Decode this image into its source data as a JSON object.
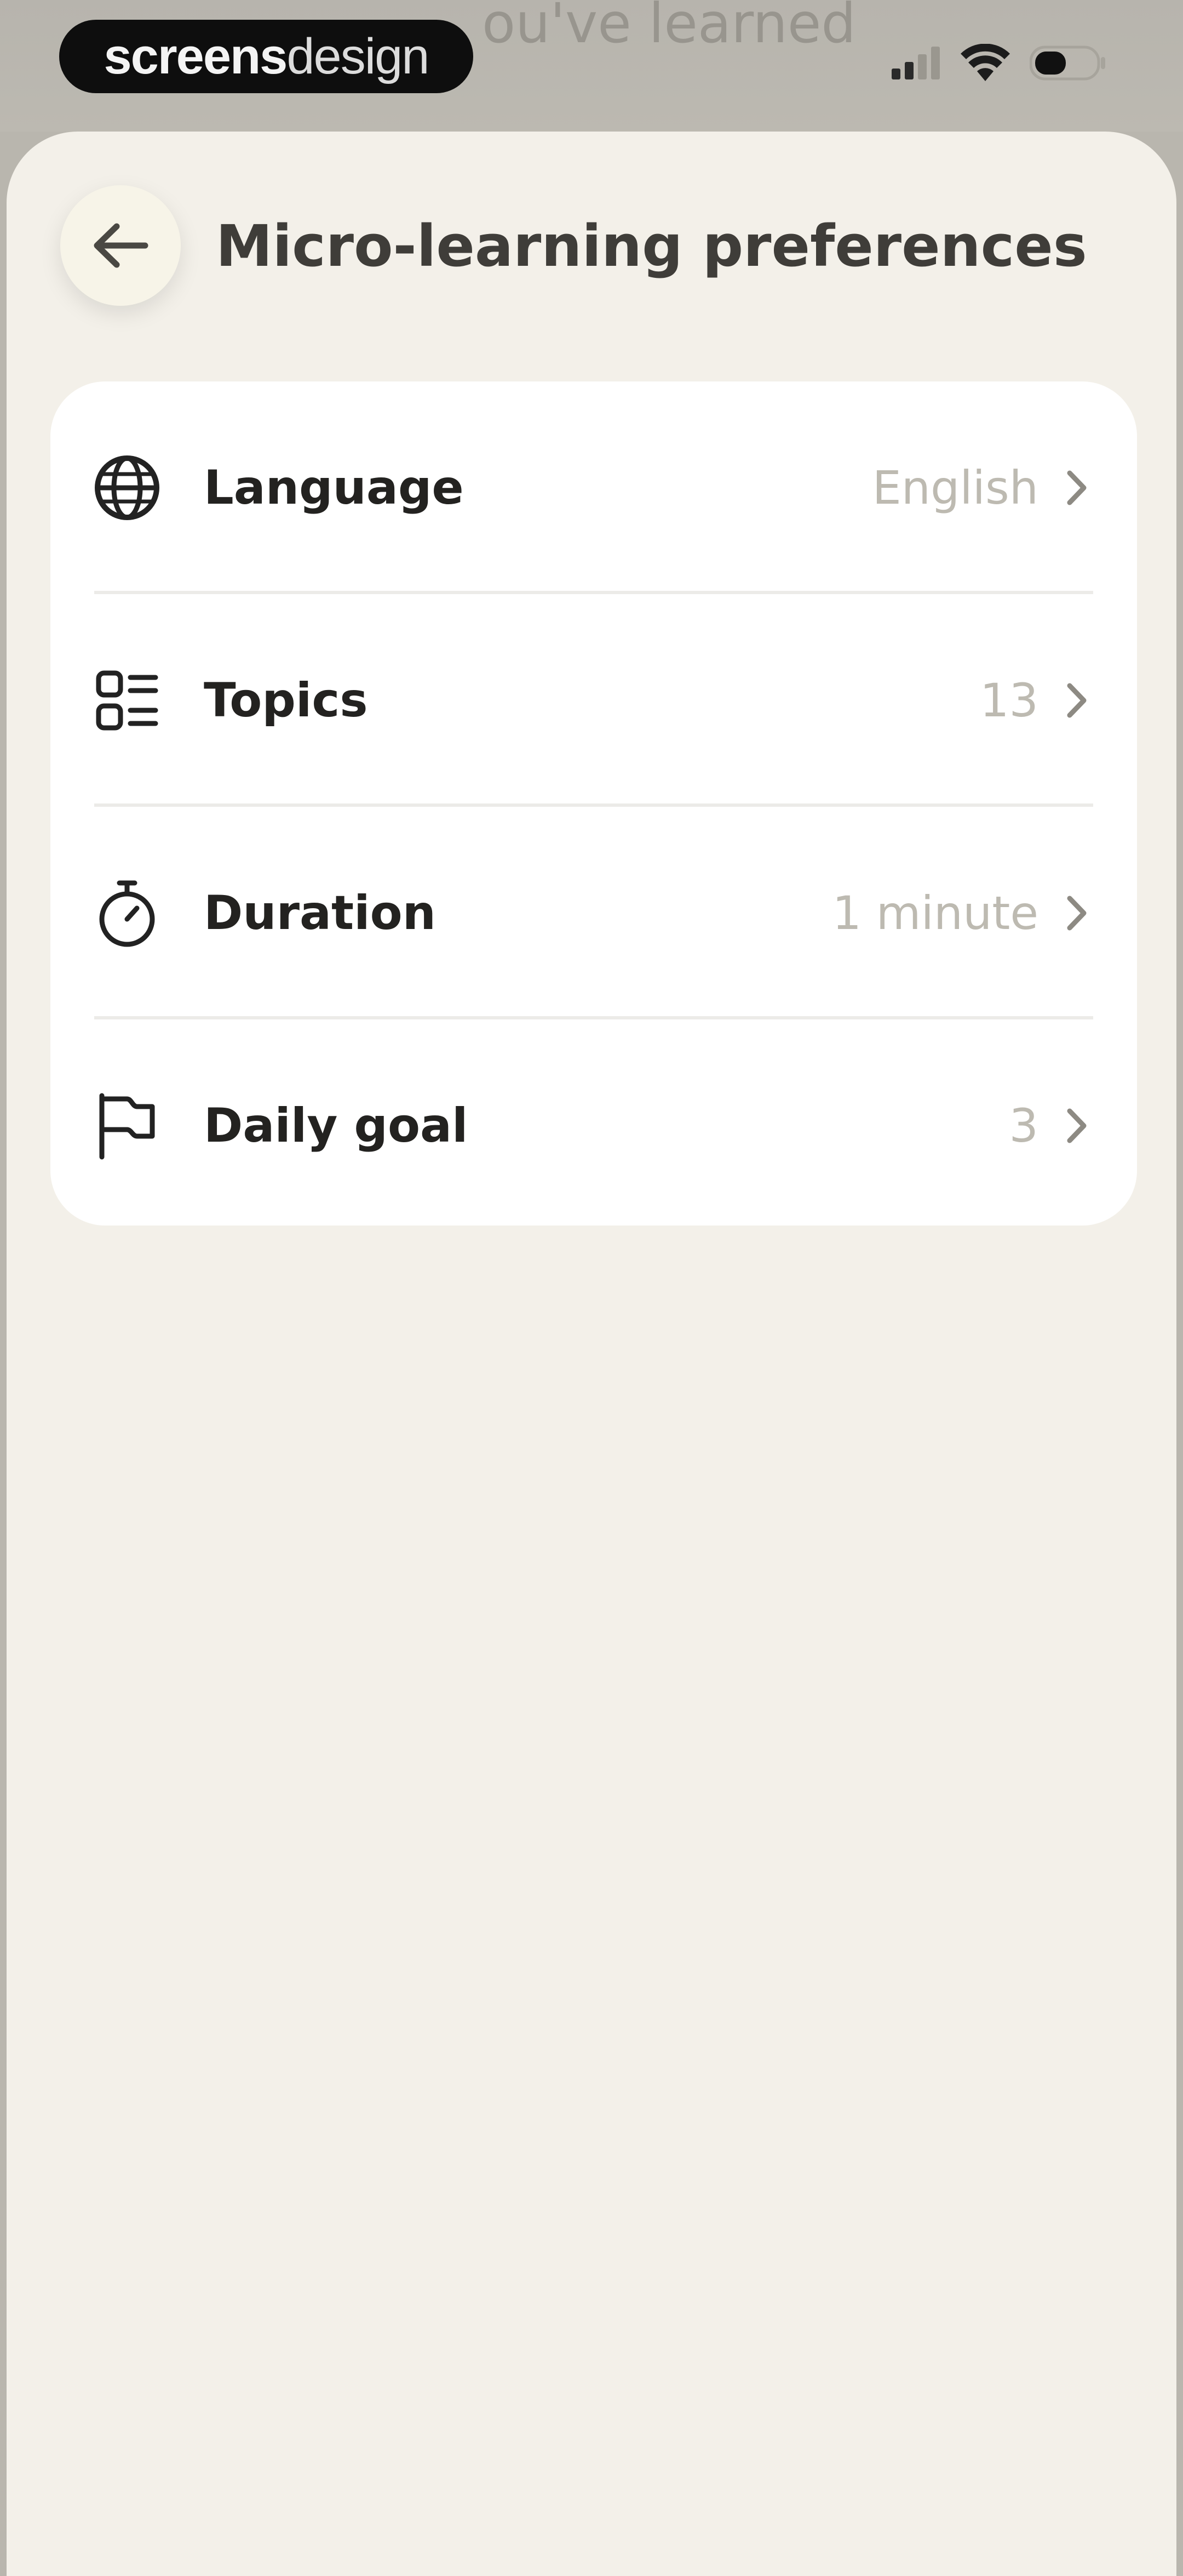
{
  "status_bar": {
    "brand_bold": "screens",
    "brand_light": "design",
    "behind_text": "ou've learned"
  },
  "header": {
    "back_label": "Back",
    "title": "Micro-learning preferences"
  },
  "settings": {
    "items": [
      {
        "icon": "globe-icon",
        "label": "Language",
        "value": "English"
      },
      {
        "icon": "topics-grid-icon",
        "label": "Topics",
        "value": "13"
      },
      {
        "icon": "stopwatch-icon",
        "label": "Duration",
        "value": "1 minute"
      },
      {
        "icon": "flag-icon",
        "label": "Daily goal",
        "value": "3"
      }
    ]
  },
  "colors": {
    "sheet_background": "#f3f0e9",
    "card_background": "#ffffff",
    "label_text": "#232220",
    "value_text": "#bdbab1",
    "title_text": "#3f3d39"
  }
}
